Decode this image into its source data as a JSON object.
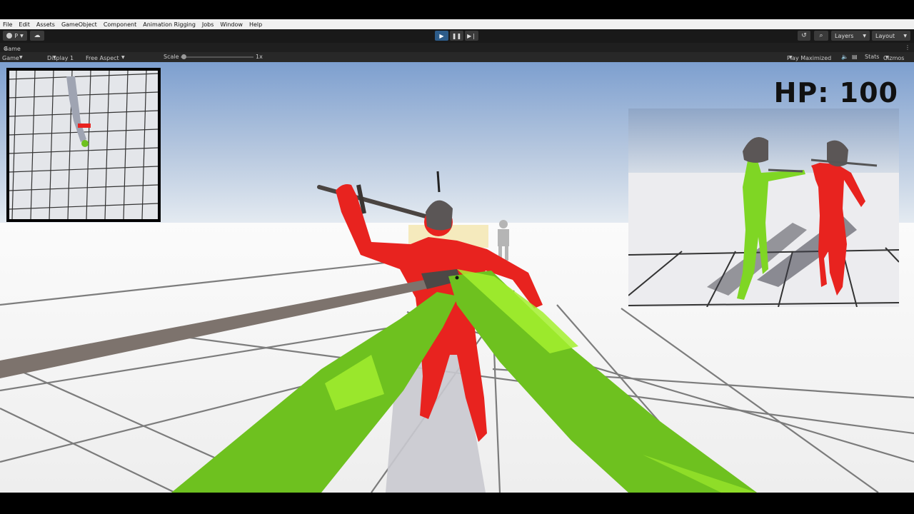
{
  "menu": [
    "File",
    "Edit",
    "Assets",
    "GameObject",
    "Component",
    "Animation Rigging",
    "Jobs",
    "Window",
    "Help"
  ],
  "toolbar": {
    "account_label": "P",
    "layers_label": "Layers",
    "layout_label": "Layout"
  },
  "tab": {
    "label": "Game"
  },
  "gamebar": {
    "mode": "Game",
    "display": "Display 1",
    "aspect": "Free Aspect",
    "scale_label": "Scale",
    "scale_value": "1x",
    "play_maximized": "Play Maximized",
    "stats": "Stats",
    "gizmos": "Gizmos"
  },
  "hud": {
    "hp_text": "HP: 100"
  },
  "colors": {
    "player": "#7fd624",
    "enemy": "#e8231f",
    "sky_top": "#7d9fcf",
    "floor": "#f4f4f2"
  }
}
